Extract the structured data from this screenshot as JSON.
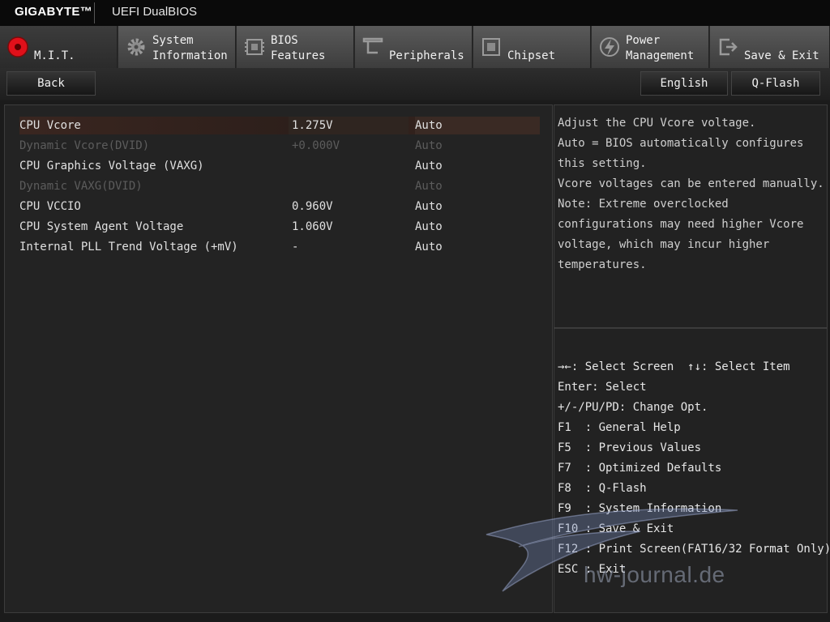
{
  "header": {
    "brand": "GIGABYTE™",
    "product": "UEFI DualBIOS"
  },
  "tabs": [
    {
      "label": "M.I.T.",
      "icon": "mit-icon",
      "active": true
    },
    {
      "label": "System\nInformation",
      "icon": "gear-icon"
    },
    {
      "label": "BIOS\nFeatures",
      "icon": "bios-chip-icon"
    },
    {
      "label": "Peripherals",
      "icon": "peripherals-icon"
    },
    {
      "label": "Chipset",
      "icon": "chipset-icon"
    },
    {
      "label": "Power\nManagement",
      "icon": "power-icon"
    },
    {
      "label": "Save & Exit",
      "icon": "exit-icon"
    }
  ],
  "nav": {
    "back": "Back",
    "language": "English",
    "qflash": "Q-Flash"
  },
  "settings": [
    {
      "name": "CPU Vcore",
      "value": "1.275V",
      "option": "Auto",
      "selected": true
    },
    {
      "name": "Dynamic Vcore(DVID)",
      "value": "+0.000V",
      "option": "Auto",
      "disabled": true
    },
    {
      "name": "CPU Graphics Voltage (VAXG)",
      "value": "",
      "option": "Auto"
    },
    {
      "name": "Dynamic VAXG(DVID)",
      "value": "",
      "option": "Auto",
      "disabled": true
    },
    {
      "name": "CPU VCCIO",
      "value": "0.960V",
      "option": "Auto"
    },
    {
      "name": "CPU System Agent Voltage",
      "value": "1.060V",
      "option": "Auto"
    },
    {
      "name": "Internal PLL Trend Voltage (+mV)",
      "value": "-",
      "option": "Auto"
    }
  ],
  "help_lines": [
    "Adjust the CPU Vcore voltage.",
    "Auto = BIOS automatically configures",
    "this setting.",
    "Vcore voltages can be entered manually.",
    "Note: Extreme overclocked",
    "configurations may need higher Vcore",
    "voltage, which may incur higher",
    "temperatures."
  ],
  "key_lines": [
    "→←: Select Screen  ↑↓: Select Item",
    "Enter: Select",
    "+/-/PU/PD: Change Opt.",
    "F1  : General Help",
    "F5  : Previous Values",
    "F7  : Optimized Defaults",
    "F8  : Q-Flash",
    "F9  : System Information",
    "F10 : Save & Exit",
    "F12 : Print Screen(FAT16/32 Format Only)",
    "ESC : Exit"
  ],
  "watermark": "hw-journal.de",
  "colors": {
    "accent_red": "#e0101a",
    "selected_row": "#3a2620"
  }
}
